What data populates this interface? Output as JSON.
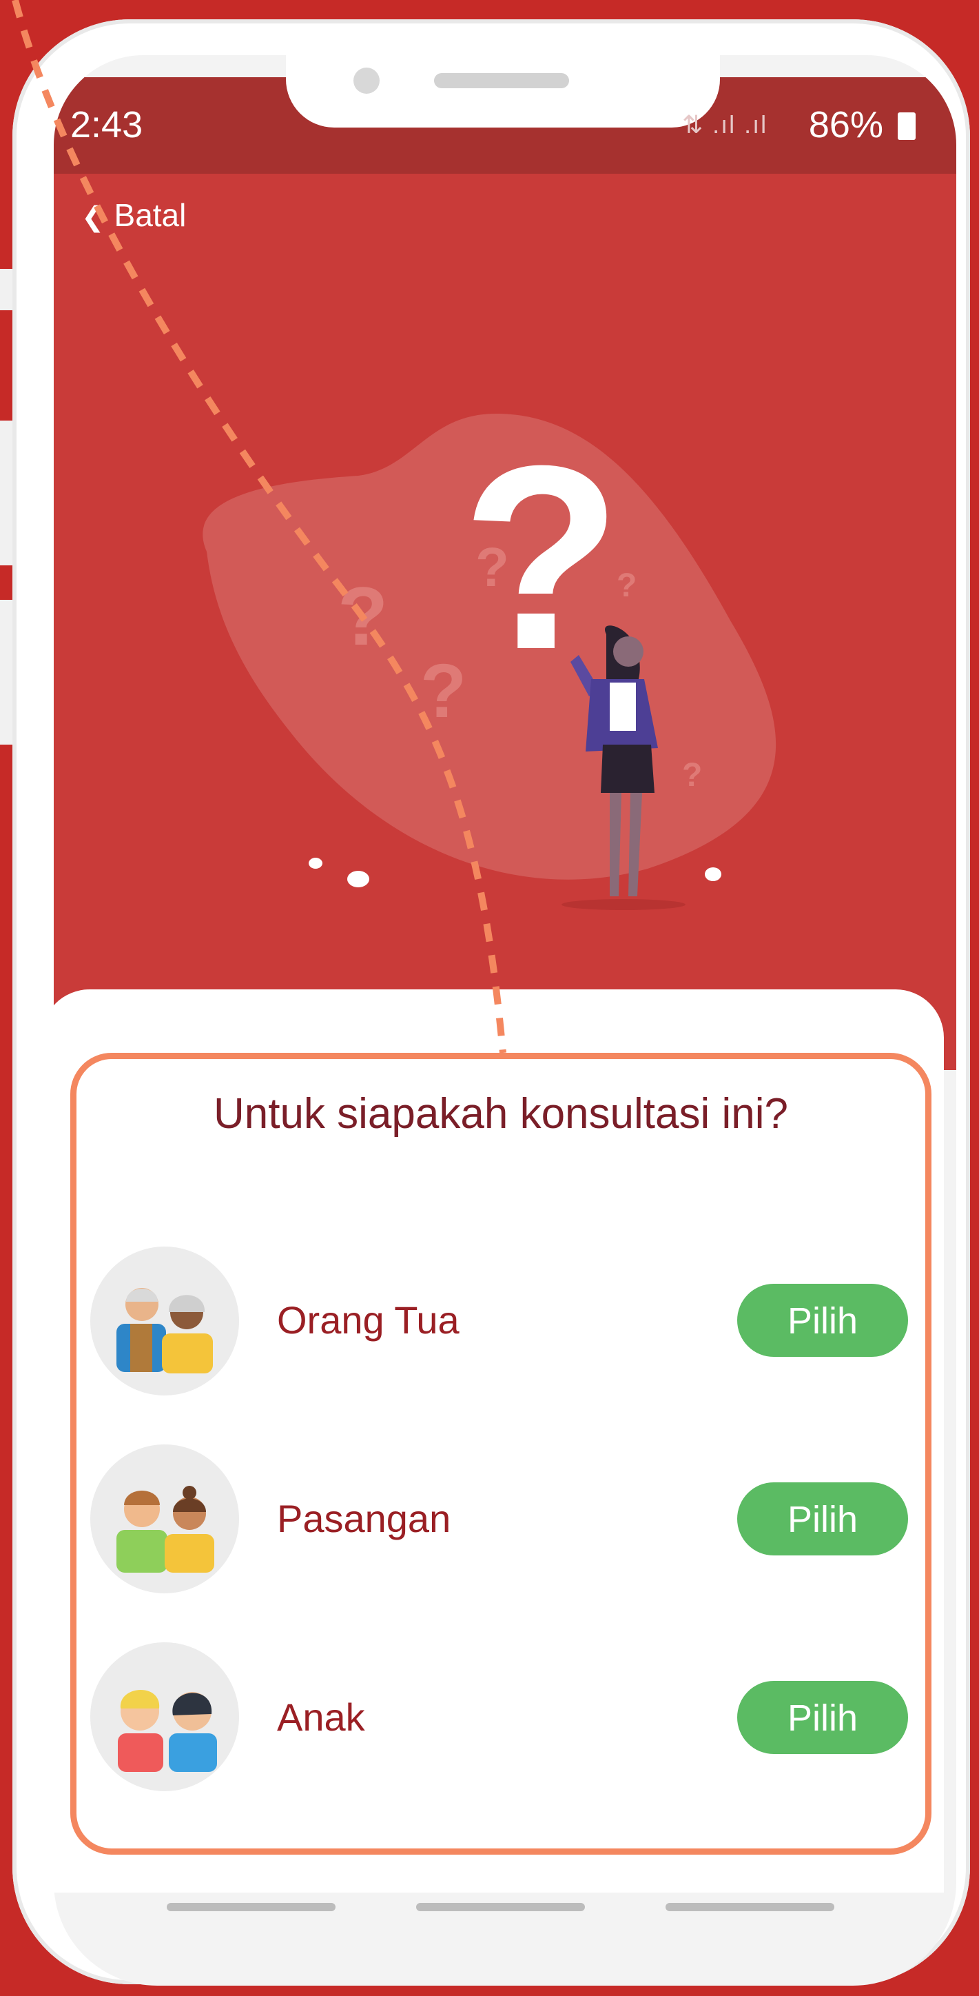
{
  "status_bar": {
    "time": "2:43",
    "signal": "⚡ .││ .││",
    "battery": "86%"
  },
  "nav": {
    "back_label": "Batal"
  },
  "sheet": {
    "question": "Untuk siapakah konsultasi ini?"
  },
  "options": [
    {
      "label": "Orang Tua",
      "button": "Pilih"
    },
    {
      "label": "Pasangan",
      "button": "Pilih"
    },
    {
      "label": "Anak",
      "button": "Pilih"
    }
  ],
  "colors": {
    "background": "#c62a27",
    "screen": "#c93b39",
    "status_bar": "#a6312f",
    "highlight": "#f4875f",
    "question_text": "#7a1e28",
    "option_text": "#9a1f24",
    "button": "#5bbb63"
  },
  "icons": [
    "chevron-left-icon",
    "battery-icon",
    "question-mark-illustration",
    "grandparents-avatar",
    "couple-avatar",
    "children-avatar"
  ]
}
